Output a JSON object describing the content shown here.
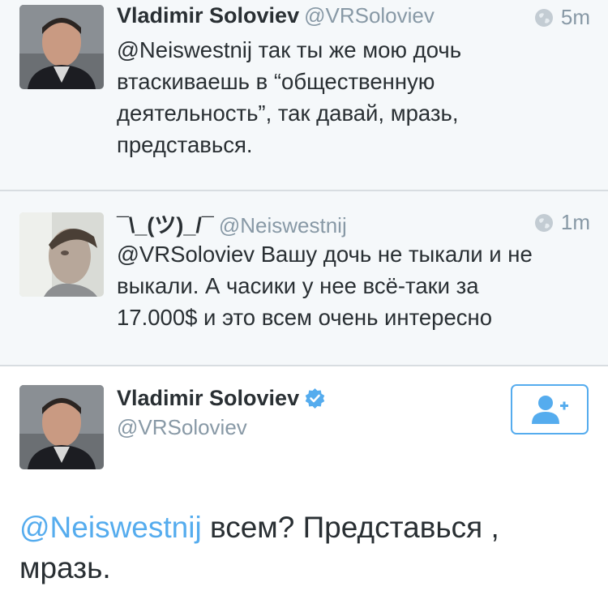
{
  "tweets": [
    {
      "name": "Vladimir Soloviev",
      "handle": "@VRSoloviev",
      "time": "5m",
      "text_lines": [
        "@Neiswestnij так ты же мою дочь",
        "втаскиваешь в “общественную",
        "деятельность”,  так давай, мразь,",
        "представься."
      ]
    },
    {
      "name": "¯\\_(ツ)_/¯",
      "handle": "@Neiswestnij",
      "time": "1m",
      "text_lines": [
        "@VRSoloviev Вашу дочь не тыкали и не",
        "выкали. А часики у нее всё-таки за",
        "17.000$ и это всем очень интересно"
      ]
    }
  ],
  "detail": {
    "name": "Vladimir Soloviev",
    "handle": "@VRSoloviev",
    "mention": "@Neiswestnij",
    "text_rest": " всем? Представься ,",
    "text_line2": "мразь."
  },
  "colors": {
    "accent": "#55acee",
    "muted": "#8899a6",
    "bg": "#f5f8fa"
  },
  "icons": {
    "time": "globe-icon",
    "verified": "verified-badge-icon",
    "follow": "add-user-icon"
  }
}
